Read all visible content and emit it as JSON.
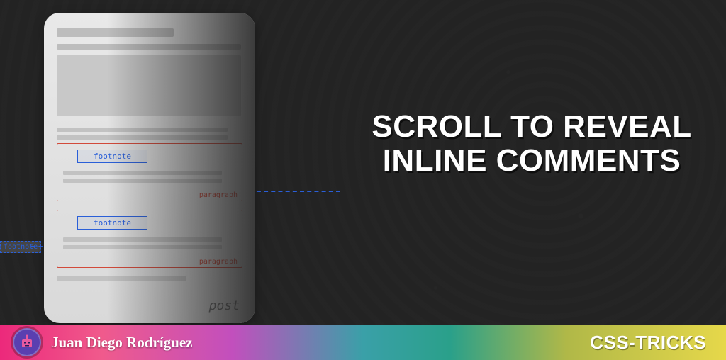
{
  "title_line1": "SCROLL TO REVEAL",
  "title_line2": "INLINE COMMENTS",
  "illustration": {
    "footnote_label": "footnote",
    "paragraph_label": "paragraph",
    "post_label": "post",
    "external_footnote_label": "footnote"
  },
  "footer": {
    "author": "Juan Diego Rodríguez",
    "site": "CSS-TRICKS"
  },
  "colors": {
    "bg": "#232323",
    "footnote_border": "#2a5fd8",
    "paragraph_border": "#d24a3a"
  }
}
